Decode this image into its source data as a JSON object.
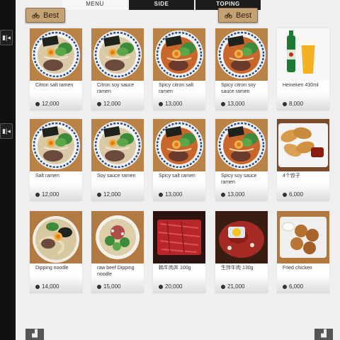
{
  "tabs": [
    {
      "label": "MENU",
      "active": true
    },
    {
      "label": "SIDE",
      "active": false
    },
    {
      "label": "TOPING",
      "active": false
    }
  ],
  "badges": [
    {
      "label": "Best",
      "icon": "bicycle-icon"
    },
    {
      "label": "Best",
      "icon": "bicycle-icon"
    }
  ],
  "items": [
    {
      "name": "Citron salt ramen",
      "price": "12,000",
      "image": "ramen-salt"
    },
    {
      "name": "Citron soy sauce ramen",
      "price": "12,000",
      "image": "ramen-salt"
    },
    {
      "name": "Spicy citron salt ramen",
      "price": "13,000",
      "image": "ramen-spicy"
    },
    {
      "name": "Spicy citron soy sauce ramen",
      "price": "13,000",
      "image": "ramen-spicy"
    },
    {
      "name": "Heineken 430ml",
      "price": "8,000",
      "image": "beer"
    },
    {
      "name": "Salt ramen",
      "price": "12,000",
      "image": "ramen-salt"
    },
    {
      "name": "Soy sauce ramen",
      "price": "12,000",
      "image": "ramen-salt"
    },
    {
      "name": "Spicy salt ramen",
      "price": "13,000",
      "image": "ramen-spicy"
    },
    {
      "name": "Spicy soy sauce ramen",
      "price": "13,000",
      "image": "ramen-spicy"
    },
    {
      "name": "4个饺子",
      "price": "6,000",
      "image": "dumplings"
    },
    {
      "name": "Dipping noodle",
      "price": "14,000",
      "image": "dipping-noodle"
    },
    {
      "name": "raw beef Dipping noodle",
      "price": "15,000",
      "image": "beef-noodle"
    },
    {
      "name": "韩牛肉丼 100g",
      "price": "20,000",
      "image": "raw-beef"
    },
    {
      "name": "生拌牛肉 130g",
      "price": "21,000",
      "image": "beef-tartare"
    },
    {
      "name": "Fried chicken",
      "price": "6,000",
      "image": "fried-chicken"
    }
  ],
  "edge_tabs": [
    {
      "icon": "grip-icon",
      "text": "▮|◂"
    },
    {
      "icon": "grip-icon",
      "text": "▮|◂"
    }
  ],
  "nav": {
    "prev_icon": "page-prev-icon",
    "next_icon": "page-next-icon"
  }
}
